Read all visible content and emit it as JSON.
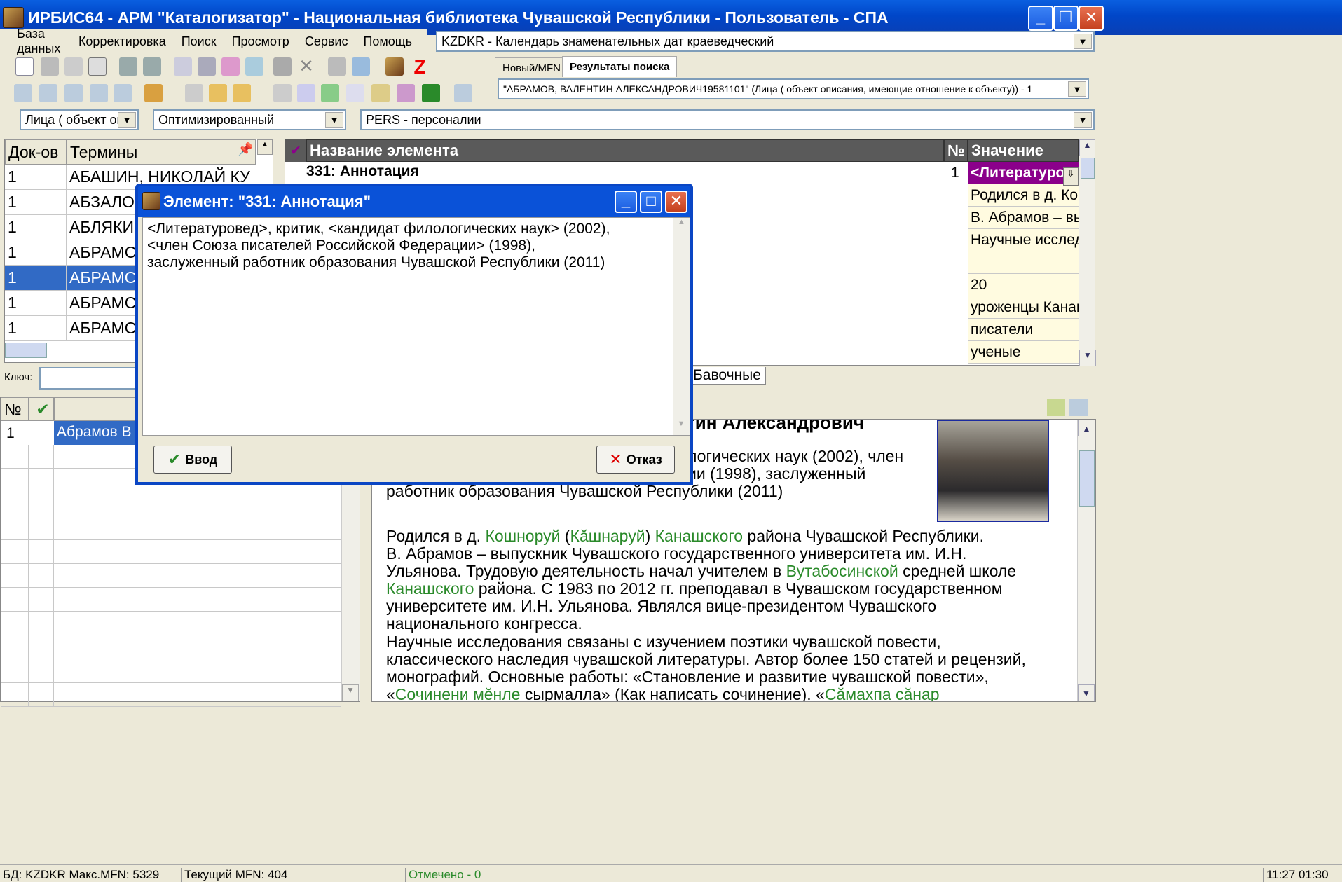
{
  "window": {
    "title": "ИРБИС64 - АРМ \"Каталогизатор\" - Национальная библиотека Чувашской Республики - Пользователь - СПА"
  },
  "menu": [
    "База данных",
    "Корректировка",
    "Поиск",
    "Просмотр",
    "Сервис",
    "Помощь"
  ],
  "db_combo": "KZDKR - Календарь знаменательных дат краеведческий",
  "tabs": {
    "new": "Новый/MFN",
    "results": "Результаты поиска"
  },
  "query_combo": "\"АБРАМОВ, ВАЛЕНТИН АЛЕКСАНДРОВИЧ19581101\" (Лица ( объект описания, имеющие отношение к объекту)) - 1",
  "prefix_combo": "Лица ( объект опи",
  "mode_combo": "Оптимизированный",
  "ws_combo": "PERS - персоналии",
  "terms": {
    "headers": {
      "docs": "Док-ов",
      "terms": "Термины"
    },
    "rows": [
      {
        "docs": "1",
        "term": "АБАШИН, НИКОЛАЙ КУ"
      },
      {
        "docs": "1",
        "term": "АБЗАЛО"
      },
      {
        "docs": "1",
        "term": "АБЛЯКИ"
      },
      {
        "docs": "1",
        "term": "АБРАМС"
      },
      {
        "docs": "1",
        "term": "АБРАМС"
      },
      {
        "docs": "1",
        "term": "АБРАМС"
      },
      {
        "docs": "1",
        "term": "АБРАМС"
      }
    ],
    "key_label": "Ключ:"
  },
  "fields": {
    "headers": {
      "name": "Название элемента",
      "num": "№",
      "value": "Значение"
    },
    "first_name": "331: Аннотация",
    "first_num": "1",
    "values": [
      "<Литературовед>, критик, <кандидат филологи",
      "Родился в д. Кошноруй (Кăшнаруй) Канашского райо",
      "В. Абрамов – выпускник Чувашского государственно",
      "Научные исследования связаны с изучением поэтик",
      "",
      "20",
      "уроженцы Канашского района",
      "писатели",
      "ученые"
    ],
    "tab_label": "Бавочные"
  },
  "results": {
    "headers": {
      "num": "№"
    },
    "first_num": "1",
    "first_text": "Абрамов В"
  },
  "dialog": {
    "title": "Элемент: \"331: Аннотация\"",
    "lines": [
      "<Литературовед>, критик, <кандидат филологических наук> (2002),",
      "<член Союза писателей Российской Федерации> (1998),",
      "заслуженный работник образования Чувашской Республики (2011)"
    ],
    "ok": "Ввод",
    "cancel": "Отказ"
  },
  "preview": {
    "heading_frag": "тин Александрович",
    "p1": [
      "логических наук (2002), член",
      "ии (1998), заслуженный",
      "работник образования Чувашской Республики (2011)"
    ],
    "p2_l1a": "Родился в д. ",
    "p2_l1_link1": "Кошноруй",
    "p2_l1b": " (",
    "p2_l1_link2": "Кăшнаруй",
    "p2_l1c": ") ",
    "p2_l1_link3": "Канашского",
    "p2_l1d": " района Чувашской Республики.",
    "p2_l2": "В. Абрамов – выпускник Чувашского государственного университета им. И.Н.",
    "p2_l3a": "Ульянова. Трудовую деятельность начал учителем в ",
    "p2_l3_link": "Вутабосинской",
    "p2_l3b": " средней школе",
    "p2_l4_link": "Канашского",
    "p2_l4b": " района. С 1983 по 2012 гг. преподавал в Чувашском государственном",
    "p2_l5": "университете им. И.Н. Ульянова. Являлся вице-президентом Чувашского",
    "p2_l6": "национального конгресса.",
    "p3_l1": "Научные исследования связаны с изучением поэтики чувашской повести,",
    "p3_l2": "классического наследия чувашской литературы. Автор более 150 статей и рецензий,",
    "p3_l3": "монографий. Основные работы: «Становление и развитие чувашской повести»,",
    "p3_l4a": "«",
    "p3_l4_link1": "Сочинени мĕнле",
    "p3_l4b": " сырмалла» (Как написать сочинение). «",
    "p3_l4_link2": "Сăмахпа сăнар"
  },
  "status": {
    "db": "БД: KZDKR Макс.MFN: 5329",
    "mfn": "Текущий MFN: 404",
    "marked": "Отмечено - 0",
    "time": "11:27 01:30"
  },
  "colors": {
    "accent": "#0a52d8",
    "purple": "#8b008b",
    "link": "#2a8a2a",
    "selected": "#316ac5"
  }
}
